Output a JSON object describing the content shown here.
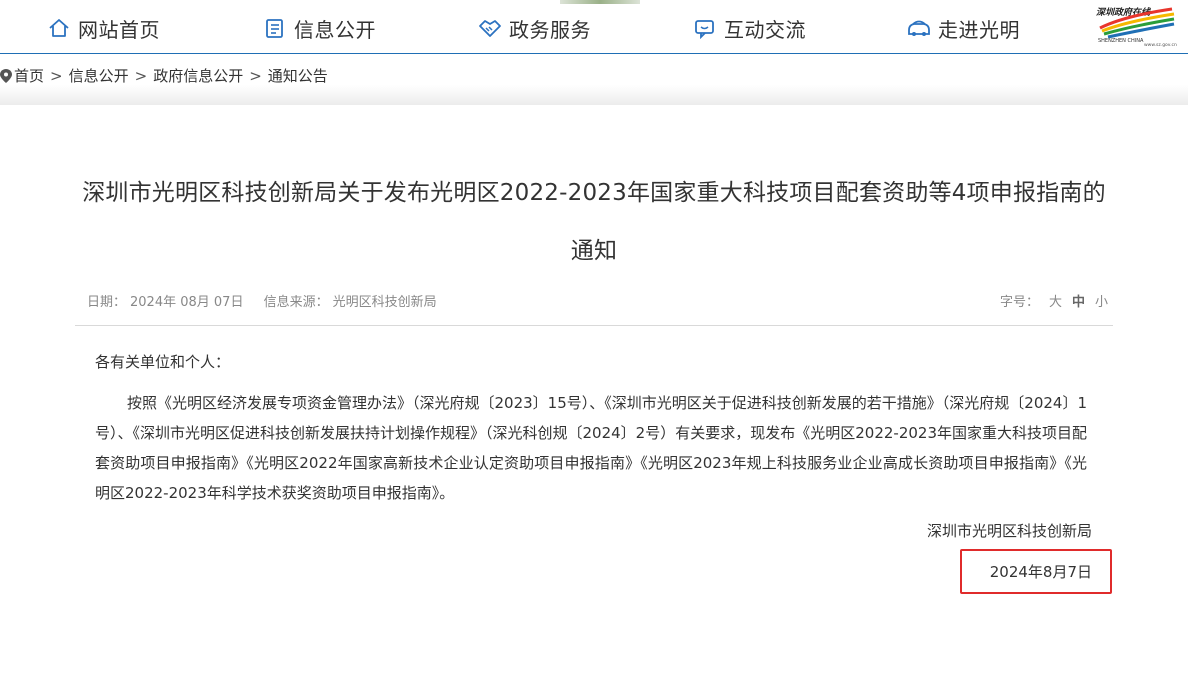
{
  "nav": {
    "items": [
      {
        "label": "网站首页",
        "icon": "home-icon"
      },
      {
        "label": "信息公开",
        "icon": "document-icon"
      },
      {
        "label": "政务服务",
        "icon": "handshake-icon"
      },
      {
        "label": "互动交流",
        "icon": "chat-icon"
      },
      {
        "label": "走进光明",
        "icon": "car-icon"
      }
    ],
    "logo_text": "深圳政府在线",
    "logo_sub": "SHENZHEN CHINA",
    "logo_url_text": "www.sz.gov.cn"
  },
  "breadcrumb": {
    "items": [
      "首页",
      "信息公开",
      "政府信息公开",
      "通知公告"
    ],
    "separator": ">"
  },
  "article": {
    "title": "深圳市光明区科技创新局关于发布光明区2022-2023年国家重大科技项目配套资助等4项申报指南的通知",
    "date_label": "日期：",
    "date_value": "2024年 08月 07日",
    "source_label": "信息来源：",
    "source_value": "光明区科技创新局",
    "fontsize_label": "字号：",
    "fontsize_options": [
      "大",
      "中",
      "小"
    ],
    "salutation": "各有关单位和个人：",
    "body": "按照《光明区经济发展专项资金管理办法》（深光府规〔2023〕15号）、《深圳市光明区关于促进科技创新发展的若干措施》（深光府规〔2024〕1号）、《深圳市光明区促进科技创新发展扶持计划操作规程》（深光科创规〔2024〕2号）有关要求，现发布《光明区2022-2023年国家重大科技项目配套资助项目申报指南》《光明区2022年国家高新技术企业认定资助项目申报指南》《光明区2023年规上科技服务业企业高成长资助项目申报指南》《光明区2022-2023年科学技术获奖资助项目申报指南》。",
    "signature": "深圳市光明区科技创新局",
    "sign_date": "2024年8月7日"
  },
  "colors": {
    "nav_border": "#1f6fb5",
    "icon_blue": "#2b72c0",
    "highlight_box": "#e02b2b"
  }
}
